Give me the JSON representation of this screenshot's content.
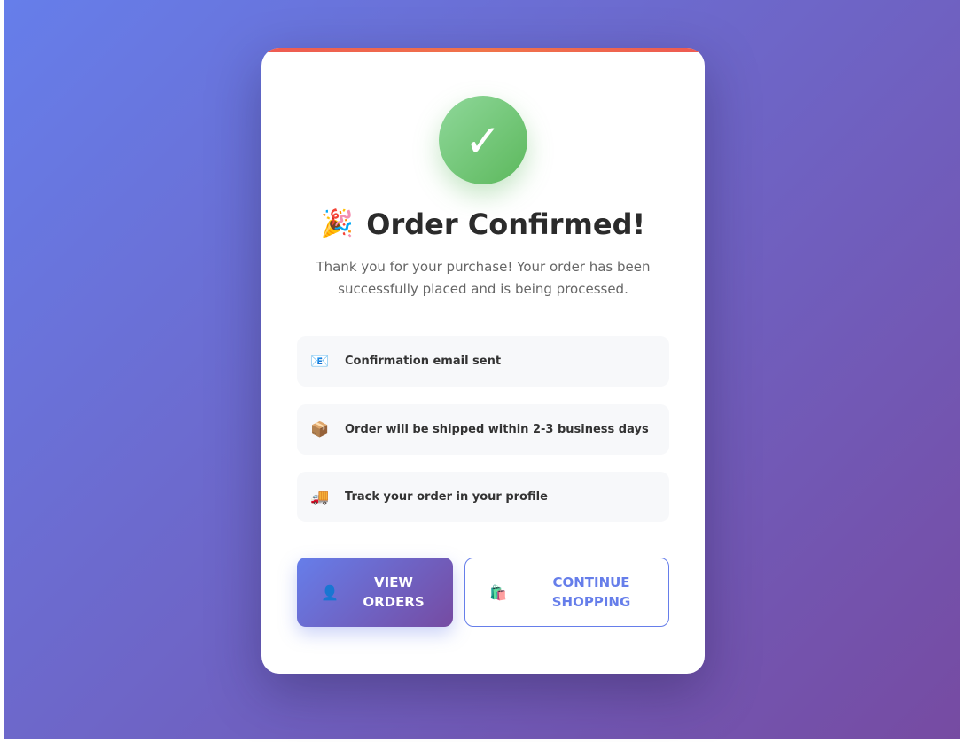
{
  "confirmation": {
    "title": "Order Confirmed!",
    "title_emoji": "🎉",
    "check_glyph": "✓",
    "subtitle": "Thank you for your purchase! Your order has been successfully placed and is being processed.",
    "info_items": [
      {
        "icon": "📧",
        "icon_name": "email-icon",
        "text": "Confirmation email sent"
      },
      {
        "icon": "📦",
        "icon_name": "package-icon",
        "text": "Order will be shipped within 2-3 business days"
      },
      {
        "icon": "🚚",
        "icon_name": "truck-icon",
        "text": "Track your order in your profile"
      }
    ],
    "buttons": {
      "view_orders": {
        "icon": "👤",
        "icon_name": "user-icon",
        "label": "VIEW ORDERS"
      },
      "continue_shopping": {
        "icon": "🛍️",
        "icon_name": "shopping-bag-icon",
        "label": "CONTINUE SHOPPING"
      }
    }
  },
  "colors": {
    "background_gradient": [
      "#667eea",
      "#764ba2"
    ],
    "success_green": "#5cb85c",
    "accent_bar": "#ee5a52",
    "text_dark": "#2b2b2b",
    "text_muted": "#666666"
  }
}
